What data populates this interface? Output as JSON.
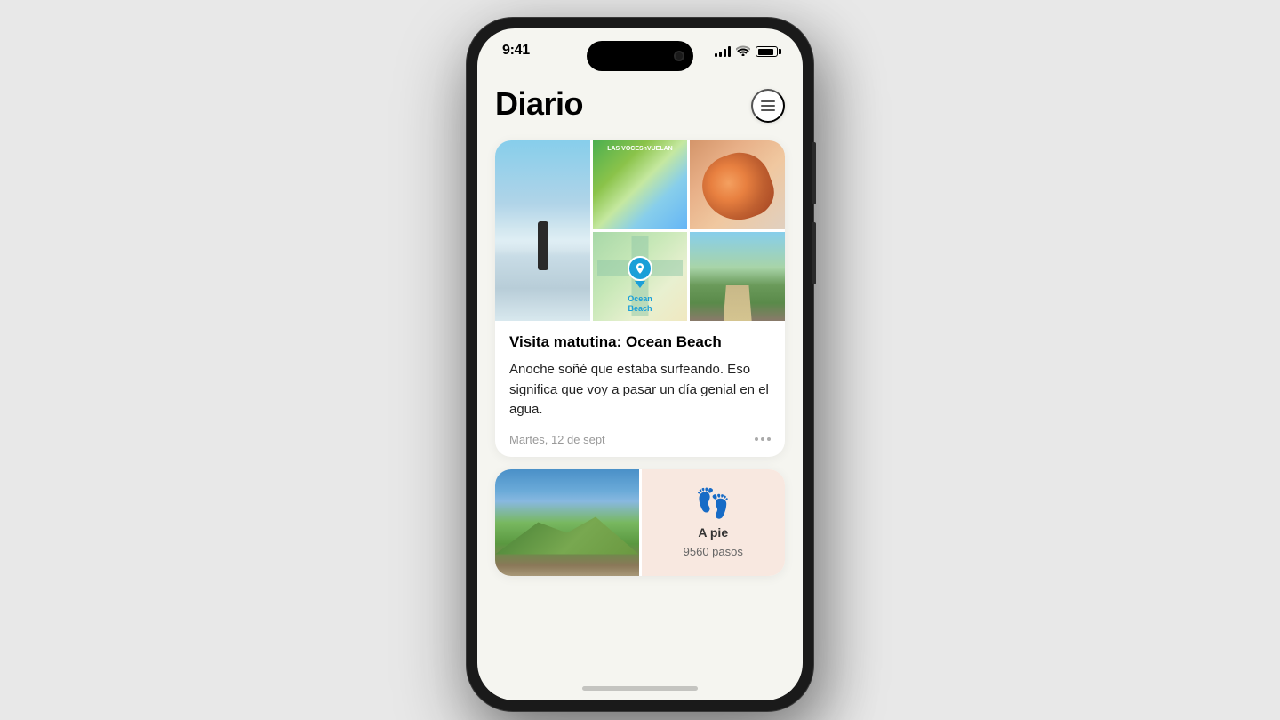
{
  "phone": {
    "status_bar": {
      "time": "9:41",
      "signal_label": "signal",
      "wifi_label": "wifi",
      "battery_label": "battery"
    }
  },
  "app": {
    "title": "Diario",
    "menu_button_label": "Menú"
  },
  "entry_card": {
    "title": "Visita matutina: Ocean Beach",
    "body": "Anoche soñé que estaba surfeando. Eso significa que voy a pasar un día genial en el agua.",
    "date": "Martes, 12 de sept",
    "more_label": "Más opciones",
    "map_label_line1": "Ocean",
    "map_label_line2": "Beach"
  },
  "second_card": {
    "steps_title": "A pie",
    "steps_count": "9560 pasos",
    "steps_icon": "👣"
  }
}
